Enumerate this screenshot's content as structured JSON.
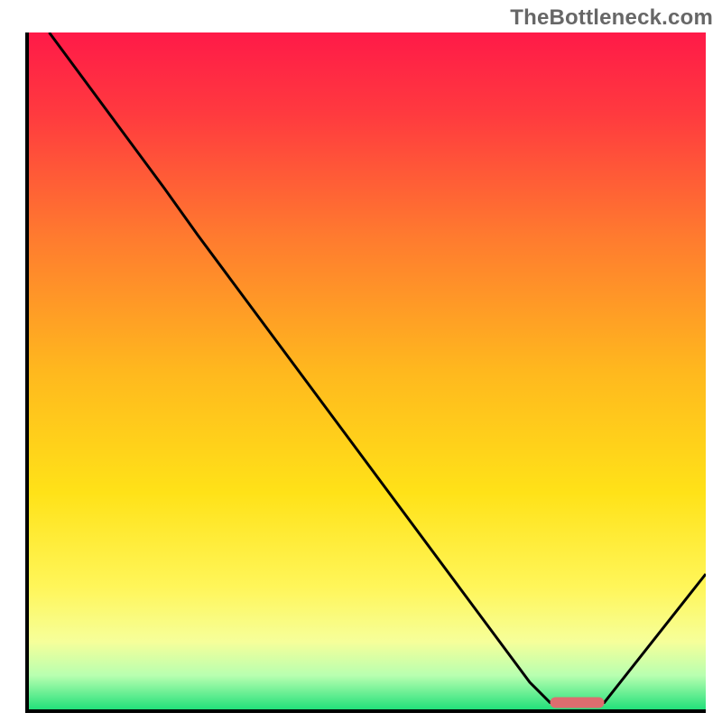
{
  "watermark": "TheBottleneck.com",
  "chart_data": {
    "type": "line",
    "title": "",
    "xlabel": "",
    "ylabel": "",
    "xlim": [
      0,
      100
    ],
    "ylim": [
      0,
      100
    ],
    "grid": false,
    "legend": false,
    "gradient_stops": [
      {
        "offset": 0.0,
        "color": "#ff1a48"
      },
      {
        "offset": 0.12,
        "color": "#ff3a3f"
      },
      {
        "offset": 0.3,
        "color": "#ff7a2f"
      },
      {
        "offset": 0.5,
        "color": "#ffb81e"
      },
      {
        "offset": 0.68,
        "color": "#ffe218"
      },
      {
        "offset": 0.82,
        "color": "#fff65a"
      },
      {
        "offset": 0.9,
        "color": "#f6ff9a"
      },
      {
        "offset": 0.95,
        "color": "#b8ffb0"
      },
      {
        "offset": 1.0,
        "color": "#22e07a"
      }
    ],
    "series": [
      {
        "name": "curve",
        "color": "#000000",
        "stroke_width": 3,
        "points": [
          {
            "x": 3,
            "y": 100
          },
          {
            "x": 20,
            "y": 77
          },
          {
            "x": 25,
            "y": 70
          },
          {
            "x": 74,
            "y": 4
          },
          {
            "x": 77,
            "y": 1
          },
          {
            "x": 85,
            "y": 1
          },
          {
            "x": 100,
            "y": 20
          }
        ]
      }
    ],
    "marker": {
      "name": "optimal-region",
      "color": "#dd6d6f",
      "x_start": 77,
      "x_end": 85,
      "y": 1,
      "thickness": 1.6,
      "cap_radius": 0.8
    }
  }
}
